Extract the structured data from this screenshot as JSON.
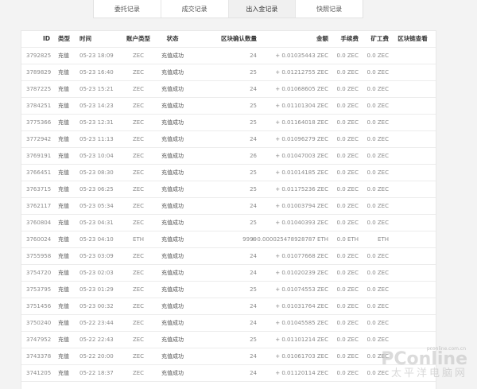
{
  "tabs": [
    {
      "label": "委托记录",
      "active": false
    },
    {
      "label": "成交记录",
      "active": false
    },
    {
      "label": "出入金记录",
      "active": true
    },
    {
      "label": "快照记录",
      "active": false
    }
  ],
  "table": {
    "headers": {
      "id": "ID",
      "type": "类型",
      "time": "时间",
      "account": "账户类型",
      "status": "状态",
      "confirmations": "区块确认数量",
      "amount": "金额",
      "fee": "手续费",
      "miner_fee": "矿工费",
      "chain": "区块链查看"
    },
    "rows": [
      {
        "id": "3792825",
        "type": "充值",
        "time": "05-23 18:09",
        "account": "ZEC",
        "status": "充值成功",
        "confirmations": "24",
        "amount": "+ 0.01035443 ZEC",
        "fee": "0.0 ZEC",
        "miner_fee": "0.0 ZEC"
      },
      {
        "id": "3789829",
        "type": "充值",
        "time": "05-23 16:40",
        "account": "ZEC",
        "status": "充值成功",
        "confirmations": "25",
        "amount": "+ 0.01212755 ZEC",
        "fee": "0.0 ZEC",
        "miner_fee": "0.0 ZEC"
      },
      {
        "id": "3787225",
        "type": "充值",
        "time": "05-23 15:21",
        "account": "ZEC",
        "status": "充值成功",
        "confirmations": "24",
        "amount": "+ 0.01068605 ZEC",
        "fee": "0.0 ZEC",
        "miner_fee": "0.0 ZEC"
      },
      {
        "id": "3784251",
        "type": "充值",
        "time": "05-23 14:23",
        "account": "ZEC",
        "status": "充值成功",
        "confirmations": "25",
        "amount": "+ 0.01101304 ZEC",
        "fee": "0.0 ZEC",
        "miner_fee": "0.0 ZEC"
      },
      {
        "id": "3775366",
        "type": "充值",
        "time": "05-23 12:31",
        "account": "ZEC",
        "status": "充值成功",
        "confirmations": "25",
        "amount": "+ 0.01164018 ZEC",
        "fee": "0.0 ZEC",
        "miner_fee": "0.0 ZEC"
      },
      {
        "id": "3772942",
        "type": "充值",
        "time": "05-23 11:13",
        "account": "ZEC",
        "status": "充值成功",
        "confirmations": "24",
        "amount": "+ 0.01096279 ZEC",
        "fee": "0.0 ZEC",
        "miner_fee": "0.0 ZEC"
      },
      {
        "id": "3769191",
        "type": "充值",
        "time": "05-23 10:04",
        "account": "ZEC",
        "status": "充值成功",
        "confirmations": "26",
        "amount": "+ 0.01047003 ZEC",
        "fee": "0.0 ZEC",
        "miner_fee": "0.0 ZEC"
      },
      {
        "id": "3766451",
        "type": "充值",
        "time": "05-23 08:30",
        "account": "ZEC",
        "status": "充值成功",
        "confirmations": "25",
        "amount": "+ 0.01014185 ZEC",
        "fee": "0.0 ZEC",
        "miner_fee": "0.0 ZEC"
      },
      {
        "id": "3763715",
        "type": "充值",
        "time": "05-23 06:25",
        "account": "ZEC",
        "status": "充值成功",
        "confirmations": "25",
        "amount": "+ 0.01175236 ZEC",
        "fee": "0.0 ZEC",
        "miner_fee": "0.0 ZEC"
      },
      {
        "id": "3762117",
        "type": "充值",
        "time": "05-23 05:34",
        "account": "ZEC",
        "status": "充值成功",
        "confirmations": "24",
        "amount": "+ 0.01003794 ZEC",
        "fee": "0.0 ZEC",
        "miner_fee": "0.0 ZEC"
      },
      {
        "id": "3760804",
        "type": "充值",
        "time": "05-23 04:31",
        "account": "ZEC",
        "status": "充值成功",
        "confirmations": "25",
        "amount": "+ 0.01040393 ZEC",
        "fee": "0.0 ZEC",
        "miner_fee": "0.0 ZEC"
      },
      {
        "id": "3760024",
        "type": "充值",
        "time": "05-23 04:10",
        "account": "ETH",
        "status": "充值成功",
        "confirmations": "9999",
        "amount": "+ 0.000025478928787 ETH",
        "fee": "0.0 ETH",
        "miner_fee": "ETH"
      },
      {
        "id": "3755958",
        "type": "充值",
        "time": "05-23 03:09",
        "account": "ZEC",
        "status": "充值成功",
        "confirmations": "24",
        "amount": "+ 0.01077668 ZEC",
        "fee": "0.0 ZEC",
        "miner_fee": "0.0 ZEC"
      },
      {
        "id": "3754720",
        "type": "充值",
        "time": "05-23 02:03",
        "account": "ZEC",
        "status": "充值成功",
        "confirmations": "24",
        "amount": "+ 0.01020239 ZEC",
        "fee": "0.0 ZEC",
        "miner_fee": "0.0 ZEC"
      },
      {
        "id": "3753795",
        "type": "充值",
        "time": "05-23 01:29",
        "account": "ZEC",
        "status": "充值成功",
        "confirmations": "25",
        "amount": "+ 0.01074553 ZEC",
        "fee": "0.0 ZEC",
        "miner_fee": "0.0 ZEC"
      },
      {
        "id": "3751456",
        "type": "充值",
        "time": "05-23 00:32",
        "account": "ZEC",
        "status": "充值成功",
        "confirmations": "24",
        "amount": "+ 0.01031764 ZEC",
        "fee": "0.0 ZEC",
        "miner_fee": "0.0 ZEC"
      },
      {
        "id": "3750240",
        "type": "充值",
        "time": "05-22 23:44",
        "account": "ZEC",
        "status": "充值成功",
        "confirmations": "24",
        "amount": "+ 0.01045585 ZEC",
        "fee": "0.0 ZEC",
        "miner_fee": "0.0 ZEC"
      },
      {
        "id": "3747952",
        "type": "充值",
        "time": "05-22 22:43",
        "account": "ZEC",
        "status": "充值成功",
        "confirmations": "25",
        "amount": "+ 0.01101214 ZEC",
        "fee": "0.0 ZEC",
        "miner_fee": "0.0 ZEC"
      },
      {
        "id": "3743378",
        "type": "充值",
        "time": "05-22 20:00",
        "account": "ZEC",
        "status": "充值成功",
        "confirmations": "24",
        "amount": "+ 0.01061703 ZEC",
        "fee": "0.0 ZEC",
        "miner_fee": "0.0 ZEC"
      },
      {
        "id": "3741205",
        "type": "充值",
        "time": "05-22 18:37",
        "account": "ZEC",
        "status": "充值成功",
        "confirmations": "24",
        "amount": "+ 0.01120114 ZEC",
        "fee": "0.0 ZEC",
        "miner_fee": "0.0 ZEC"
      }
    ]
  },
  "watermark": {
    "main": "PConline",
    "sub": "太平洋电脑网",
    "url": "pconline.com.cn"
  }
}
